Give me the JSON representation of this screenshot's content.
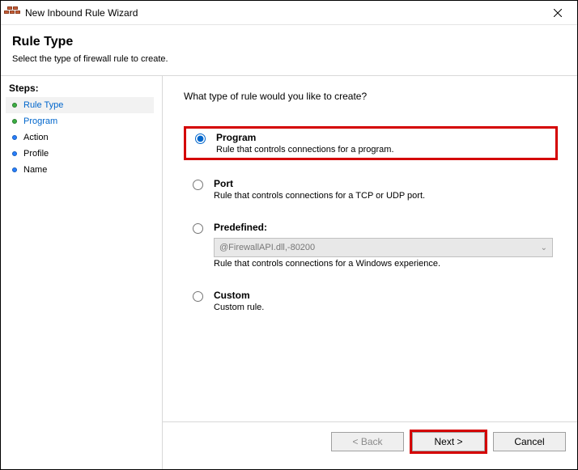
{
  "window": {
    "title": "New Inbound Rule Wizard"
  },
  "header": {
    "title": "Rule Type",
    "subtitle": "Select the type of firewall rule to create."
  },
  "sidebar": {
    "label": "Steps:",
    "items": [
      {
        "label": "Rule Type"
      },
      {
        "label": "Program"
      },
      {
        "label": "Action"
      },
      {
        "label": "Profile"
      },
      {
        "label": "Name"
      }
    ]
  },
  "main": {
    "question": "What type of rule would you like to create?",
    "options": {
      "program": {
        "title": "Program",
        "desc": "Rule that controls connections for a program."
      },
      "port": {
        "title": "Port",
        "desc": "Rule that controls connections for a TCP or UDP port."
      },
      "predefined": {
        "title": "Predefined:",
        "select_value": "@FirewallAPI.dll,-80200",
        "desc": "Rule that controls connections for a Windows experience."
      },
      "custom": {
        "title": "Custom",
        "desc": "Custom rule."
      }
    }
  },
  "footer": {
    "back": "< Back",
    "next": "Next >",
    "cancel": "Cancel"
  }
}
